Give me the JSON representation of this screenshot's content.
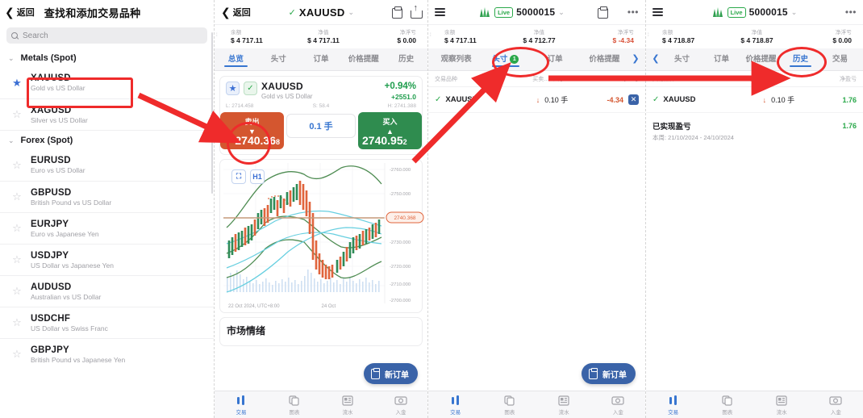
{
  "panel1": {
    "back_label": "返回",
    "title": "查找和添加交易品种",
    "search_placeholder": "Search",
    "groups": [
      {
        "name": "Metals (Spot)",
        "symbols": [
          {
            "code": "XAUUSD",
            "desc": "Gold vs US Dollar",
            "favorite": true
          },
          {
            "code": "XAGUSD",
            "desc": "Silver vs US Dollar",
            "favorite": false
          }
        ]
      },
      {
        "name": "Forex (Spot)",
        "symbols": [
          {
            "code": "EURUSD",
            "desc": "Euro vs US Dollar",
            "favorite": false
          },
          {
            "code": "GBPUSD",
            "desc": "British Pound vs US Dollar",
            "favorite": false
          },
          {
            "code": "EURJPY",
            "desc": "Euro vs Japanese Yen",
            "favorite": false
          },
          {
            "code": "USDJPY",
            "desc": "US Dollar vs Japanese Yen",
            "favorite": false
          },
          {
            "code": "AUDUSD",
            "desc": "Australian vs US Dollar",
            "favorite": false
          },
          {
            "code": "USDCHF",
            "desc": "US Dollar vs Swiss Franc",
            "favorite": false
          },
          {
            "code": "GBPJPY",
            "desc": "British Pound vs Japanese Yen",
            "favorite": false
          }
        ]
      }
    ]
  },
  "panel2": {
    "back_label": "返回",
    "symbol": "XAUUSD",
    "account": {
      "balance_label": "余额",
      "balance_value": "$ 4 717.11",
      "equity_label": "净值",
      "equity_value": "$ 4 717.11",
      "floating_label": "净浮亏",
      "floating_value": "$ 0.00"
    },
    "tabs": [
      {
        "label": "总览",
        "active": true
      },
      {
        "label": "头寸",
        "active": false
      },
      {
        "label": "订单",
        "active": false
      },
      {
        "label": "价格提醒",
        "active": false
      },
      {
        "label": "历史",
        "active": false
      }
    ],
    "quote": {
      "name": "XAUUSD",
      "desc": "Gold vs US Dollar",
      "percent": "+0.94%",
      "change": "+2551.0",
      "low": "L: 2714.458",
      "spread": "S: 58.4",
      "high": "H: 2741.388",
      "sell_label": "卖出",
      "sell_arrow": "▼",
      "sell_price_main": "2740.36",
      "sell_price_sub": "8",
      "lot_size": "0.1 手",
      "buy_label": "买入",
      "buy_arrow": "▲",
      "buy_price_main": "2740.95",
      "buy_price_sub": "2"
    },
    "chart": {
      "timeframe": "H1",
      "fullscreen_icon": "expand-icon",
      "price_tag": "2740.368",
      "x_labels": [
        "22 Oct 2024, UTC+8:00",
        "24 Oct"
      ],
      "y_labels": [
        "2760.000",
        "2750.000",
        "2730.000",
        "2720.000",
        "2710.000",
        "2700.000"
      ]
    },
    "sentiment_title": "市场情绪",
    "new_order_label": "新订单",
    "bottom_nav": [
      {
        "label": "交易",
        "icon": "candles-icon",
        "active": true
      },
      {
        "label": "图表",
        "icon": "charts-icon",
        "active": false
      },
      {
        "label": "流水",
        "icon": "journal-icon",
        "active": false
      },
      {
        "label": "入金",
        "icon": "deposit-icon",
        "active": false
      }
    ]
  },
  "panel3": {
    "live_badge": "Live",
    "account_number": "5000015",
    "account": {
      "balance_label": "余额",
      "balance_value": "$ 4 717.11",
      "equity_label": "净值",
      "equity_value": "$ 4 712.77",
      "floating_label": "净浮亏",
      "floating_value": "$ -4.34"
    },
    "tabs": [
      {
        "label": "观察列表",
        "active": false,
        "badge": null
      },
      {
        "label": "头寸",
        "active": true,
        "badge": "1"
      },
      {
        "label": "订单",
        "active": false,
        "badge": null
      },
      {
        "label": "价格提醒",
        "active": false,
        "badge": null
      }
    ],
    "table_headers": [
      "交易品种",
      "买卖...",
      "大小",
      "净盈亏"
    ],
    "positions": [
      {
        "symbol": "XAUUSD",
        "direction": "↓",
        "size": "0.10 手",
        "profit": "-4.34",
        "profit_sign": "neg",
        "close_icon": "✕"
      }
    ],
    "new_order_label": "新订单",
    "bottom_nav": [
      {
        "label": "交易",
        "icon": "candles-icon",
        "active": true
      },
      {
        "label": "图表",
        "icon": "charts-icon",
        "active": false
      },
      {
        "label": "流水",
        "icon": "journal-icon",
        "active": false
      },
      {
        "label": "入金",
        "icon": "deposit-icon",
        "active": false
      }
    ]
  },
  "panel4": {
    "live_badge": "Live",
    "account_number": "5000015",
    "account": {
      "balance_label": "余额",
      "balance_value": "$ 4 718.87",
      "equity_label": "净值",
      "equity_value": "$ 4 718.87",
      "floating_label": "净浮亏",
      "floating_value": "$ 0.00"
    },
    "tabs": [
      {
        "label": "头寸",
        "active": false
      },
      {
        "label": "订单",
        "active": false
      },
      {
        "label": "价格提醒",
        "active": false
      },
      {
        "label": "历史",
        "active": true
      },
      {
        "label": "交易",
        "active": false
      }
    ],
    "table_headers": [
      "交易品种",
      "买卖...",
      "大小",
      "净盈亏"
    ],
    "rows": [
      {
        "symbol": "XAUUSD",
        "direction": "↓",
        "size": "0.10 手",
        "profit": "1.76",
        "profit_sign": "pos"
      }
    ],
    "summary_label": "已实现盈亏",
    "summary_value": "1.76",
    "summary_period": "本周: 21/10/2024 - 24/10/2024",
    "bottom_nav": [
      {
        "label": "交易",
        "icon": "candles-icon",
        "active": true
      },
      {
        "label": "图表",
        "icon": "charts-icon",
        "active": false
      },
      {
        "label": "流水",
        "icon": "journal-icon",
        "active": false
      },
      {
        "label": "入金",
        "icon": "deposit-icon",
        "active": false
      }
    ]
  },
  "annotations": {
    "highlight_color": "#ef2b2b",
    "shapes": [
      "symbol-row-box",
      "sell-button-circle",
      "positions-tab-circle",
      "history-tab-circle"
    ],
    "arrows": [
      "arrow-to-sell-button",
      "arrow-to-positions-tab",
      "arrow-to-history-tab"
    ]
  }
}
